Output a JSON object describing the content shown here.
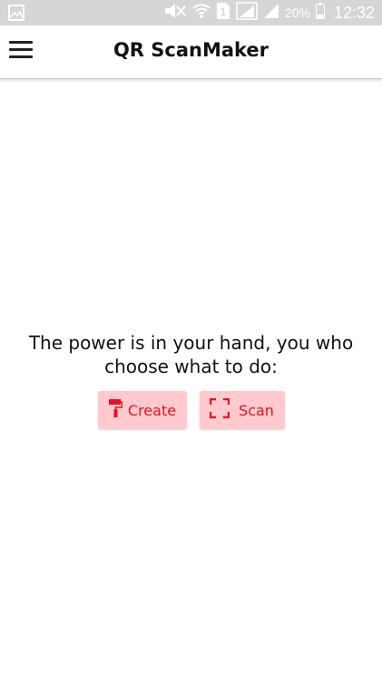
{
  "status_bar": {
    "battery_percent": "20%",
    "time": "12:32",
    "sim_badge": "1",
    "icons": [
      "gallery-icon",
      "mute-icon",
      "wifi-icon",
      "sim-icon",
      "signal-icon",
      "signal-icon-2",
      "battery-icon"
    ]
  },
  "app_bar": {
    "title": "QR ScanMaker",
    "menu_icon": "hamburger-menu-icon"
  },
  "main": {
    "tagline": "The power is in your hand, you who choose what to do:",
    "buttons": {
      "create_label": "Create",
      "create_icon": "paint-roller-icon",
      "scan_label": "Scan",
      "scan_icon": "scan-frame-icon"
    }
  },
  "colors": {
    "status_bar_bg": "#d6d6d6",
    "button_bg": "#ffc9ce",
    "button_text": "#e8101f",
    "title_text": "#111111"
  }
}
